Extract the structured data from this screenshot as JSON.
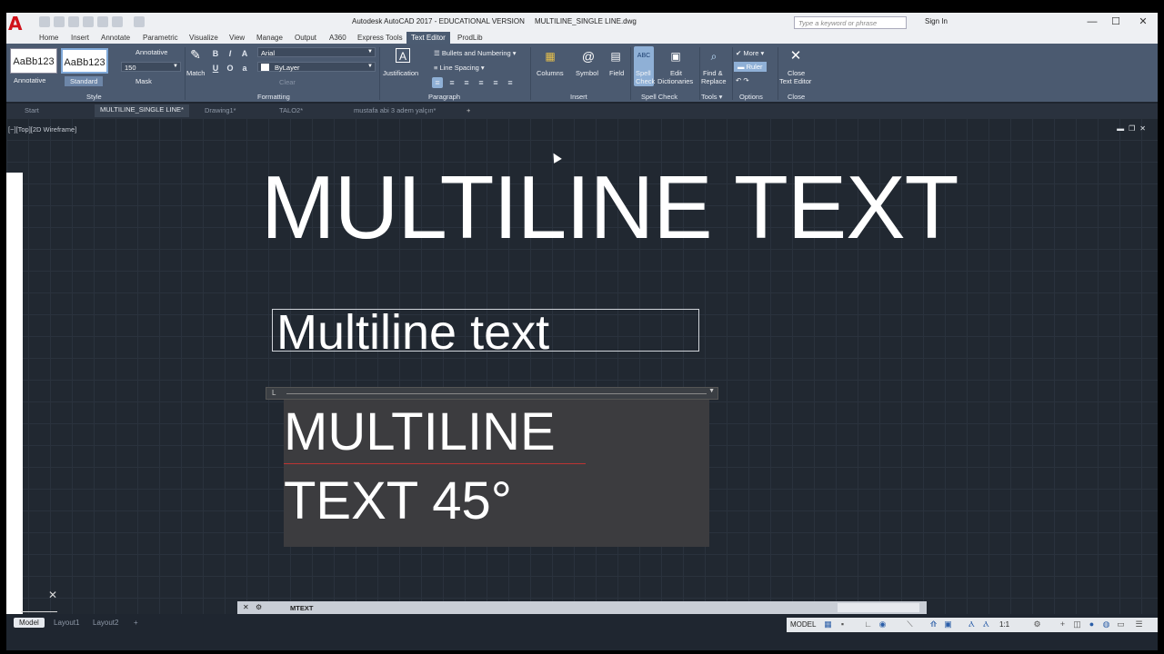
{
  "app": {
    "title": "Autodesk AutoCAD 2017 - EDUCATIONAL VERSION     MULTILINE_SINGLE LINE.dwg",
    "search_placeholder": "Type a keyword or phrase",
    "sign_in": "Sign In",
    "logo_letter": "A",
    "brand_color": "#d0121b"
  },
  "ribbon_tabs": [
    "Home",
    "Insert",
    "Annotate",
    "Parametric",
    "Visualize",
    "View",
    "Manage",
    "Output",
    "A360",
    "Express Tools",
    "Text Editor",
    "ProdLib"
  ],
  "active_tab": "Text Editor",
  "ribbon": {
    "style": {
      "swatch1": "AaBb123",
      "swatch2": "AaBb123",
      "annotative_top": "Annotative",
      "height_value": "150",
      "mask": "Mask",
      "swatch1_label": "Annotative",
      "swatch2_label": "Standard",
      "group": "Style"
    },
    "formatting": {
      "match": "Match",
      "font": "Arial",
      "color": "ByLayer",
      "clear": "Clear",
      "group": "Formatting"
    },
    "paragraph": {
      "justification": "Justification",
      "bullets": "Bullets and Numbering",
      "line_spacing": "Line Spacing",
      "group": "Paragraph"
    },
    "insert": {
      "columns": "Columns",
      "symbol": "Symbol",
      "field": "Field",
      "group": "Insert"
    },
    "spell": {
      "spell_check_1": "Spell",
      "spell_check_2": "Check",
      "edit_dict_1": "Edit",
      "edit_dict_2": "Dictionaries",
      "group": "Spell Check"
    },
    "tools": {
      "find_1": "Find &",
      "find_2": "Replace",
      "group": "Tools"
    },
    "options": {
      "more": "More",
      "ruler": "Ruler",
      "group": "Options"
    },
    "close": {
      "close_1": "Close",
      "close_2": "Text Editor",
      "group": "Close"
    }
  },
  "doc_tabs": [
    "Start",
    "MULTILINE_SINGLE LINE*",
    "Drawing1*",
    "TALO2*",
    "mustafa abi 3 adem yalçın*"
  ],
  "viewport": {
    "label": "[−][Top][2D Wireframe]",
    "big_text": "MULTILINE TEXT",
    "mid_text": "Multiline text",
    "edit_line1": "MULTILINE",
    "edit_line2": "TEXT 45°"
  },
  "command": {
    "text": "MTEXT"
  },
  "layout_tabs": [
    "Model",
    "Layout1",
    "Layout2"
  ],
  "status": {
    "model": "MODEL",
    "scale": "1:1"
  }
}
